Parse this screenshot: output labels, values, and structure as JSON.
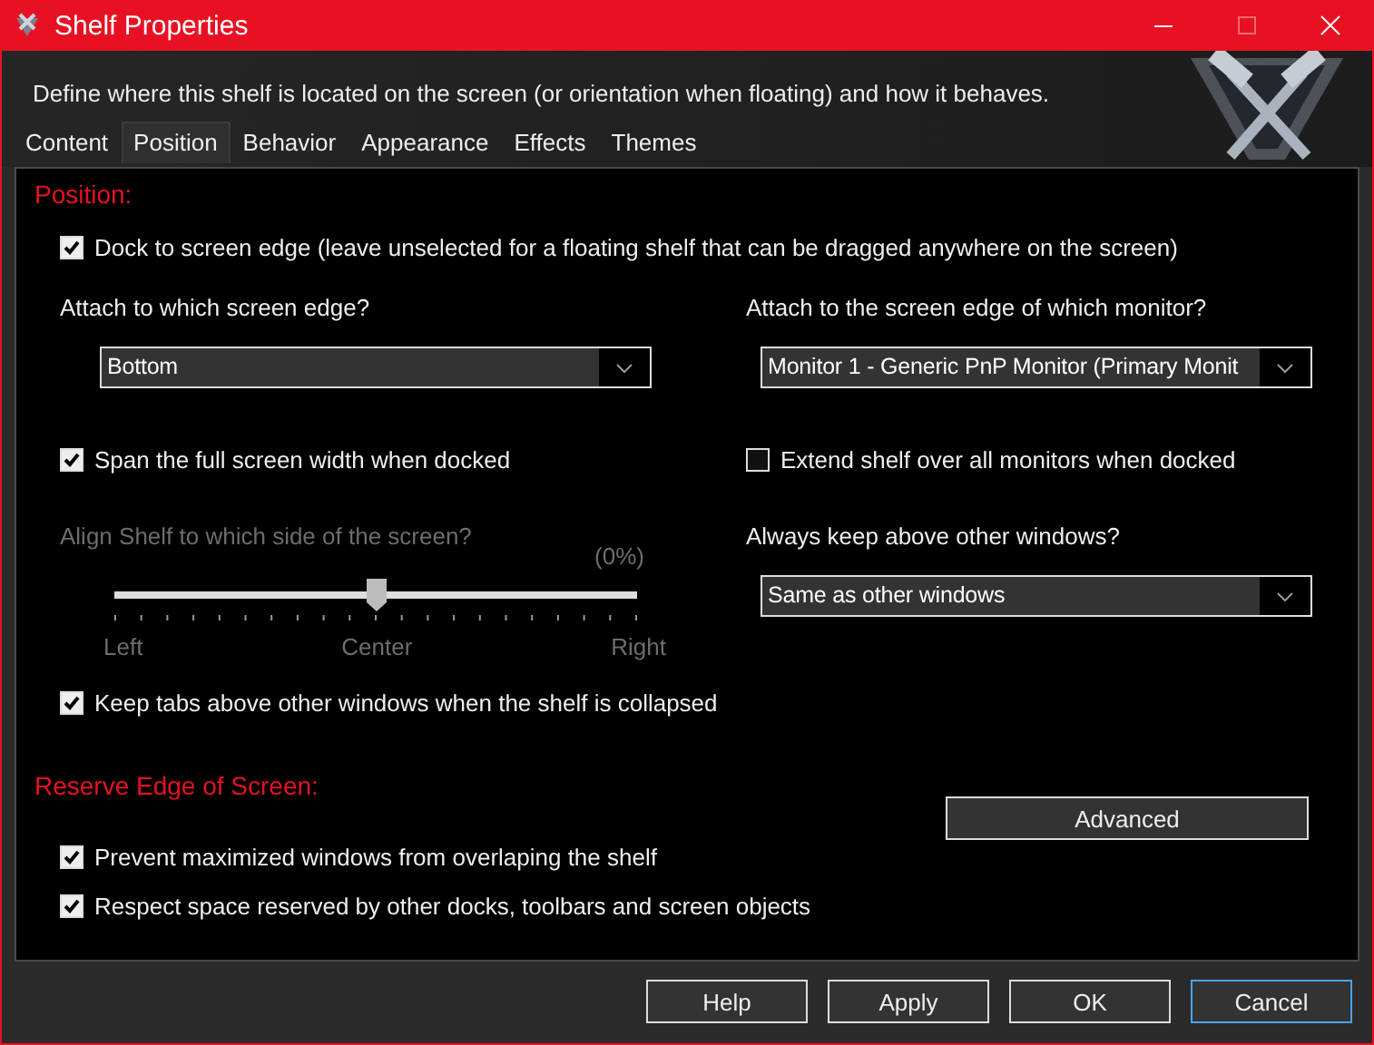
{
  "window": {
    "title": "Shelf Properties"
  },
  "header": {
    "description": "Define where this shelf is located on the screen (or orientation when floating) and how it behaves."
  },
  "tabs": [
    {
      "label": "Content",
      "selected": false
    },
    {
      "label": "Position",
      "selected": true
    },
    {
      "label": "Behavior",
      "selected": false
    },
    {
      "label": "Appearance",
      "selected": false
    },
    {
      "label": "Effects",
      "selected": false
    },
    {
      "label": "Themes",
      "selected": false
    }
  ],
  "position": {
    "heading": "Position:",
    "dock": {
      "label": "Dock to screen edge (leave unselected for a floating shelf that can be dragged anywhere on the screen)",
      "checked": true
    },
    "edge": {
      "label": "Attach to which screen edge?",
      "value": "Bottom"
    },
    "monitor": {
      "label": "Attach to the screen edge of which monitor?",
      "value": "Monitor 1 - Generic PnP Monitor (Primary Monit"
    },
    "span": {
      "label": "Span the full screen width when docked",
      "checked": true
    },
    "extend": {
      "label": "Extend shelf over all monitors when docked",
      "checked": false
    },
    "align": {
      "label": "Align Shelf to which side of the screen?",
      "disabled": true,
      "reading": "(0%)",
      "level": 0.5,
      "scale": [
        "Left",
        "Center",
        "Right"
      ]
    },
    "above": {
      "label": "Always keep above other windows?",
      "value": "Same as other windows"
    },
    "keep_tabs": {
      "label": "Keep tabs above other windows when the shelf is collapsed",
      "checked": true
    }
  },
  "reserve": {
    "heading": "Reserve Edge of Screen:",
    "checks": [
      {
        "label": "Prevent maximized windows from overlaping the shelf",
        "checked": true
      },
      {
        "label": "Respect space reserved by other docks, toolbars and screen objects",
        "checked": true
      }
    ],
    "advanced_button": "Advanced"
  },
  "buttons": [
    {
      "label": "Help",
      "focused": false
    },
    {
      "label": "Apply",
      "focused": false
    },
    {
      "label": "OK",
      "focused": false
    },
    {
      "label": "Cancel",
      "focused": true
    }
  ]
}
